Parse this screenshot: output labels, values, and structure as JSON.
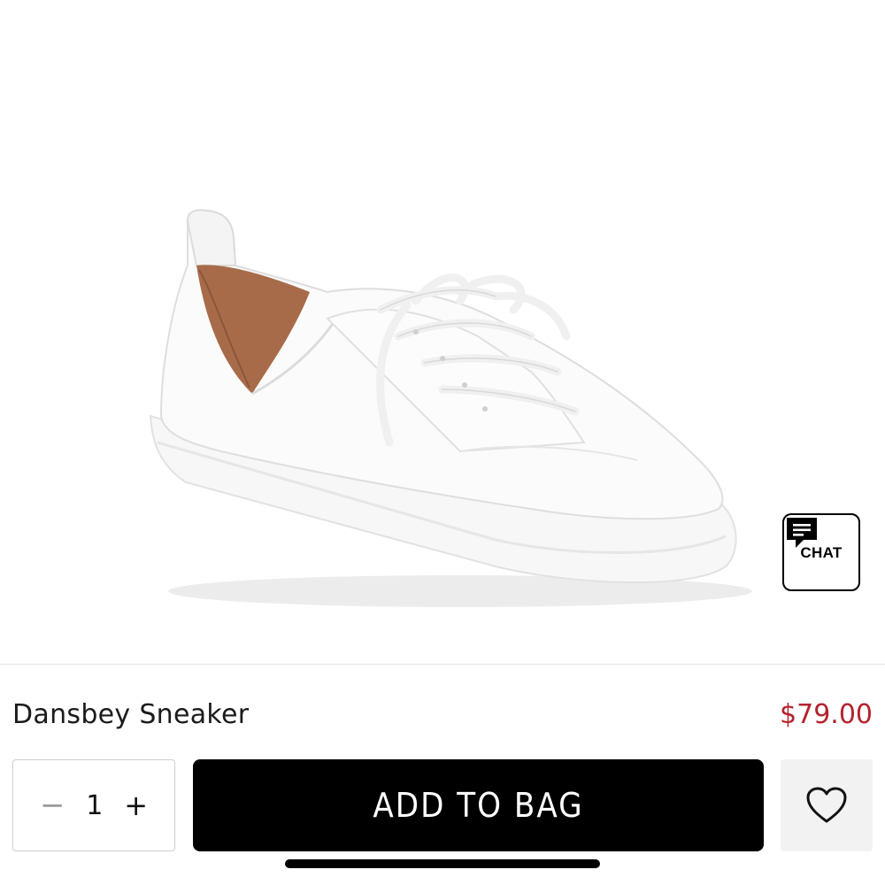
{
  "product": {
    "name": "Dansbey Sneaker",
    "price": "$79.00",
    "image_alt": "white-leather-lace-up-sneaker"
  },
  "chat": {
    "label": "CHAT",
    "icon": "chat-bubble-icon"
  },
  "quantity": {
    "value": "1",
    "decrement_symbol": "−",
    "increment_symbol": "+"
  },
  "actions": {
    "add_to_bag_label": "ADD TO BAG",
    "wishlist_icon": "heart-icon"
  },
  "colors": {
    "price": "#b3232e",
    "primary_button": "#000000",
    "wishlist_bg": "#f2f2f2"
  }
}
